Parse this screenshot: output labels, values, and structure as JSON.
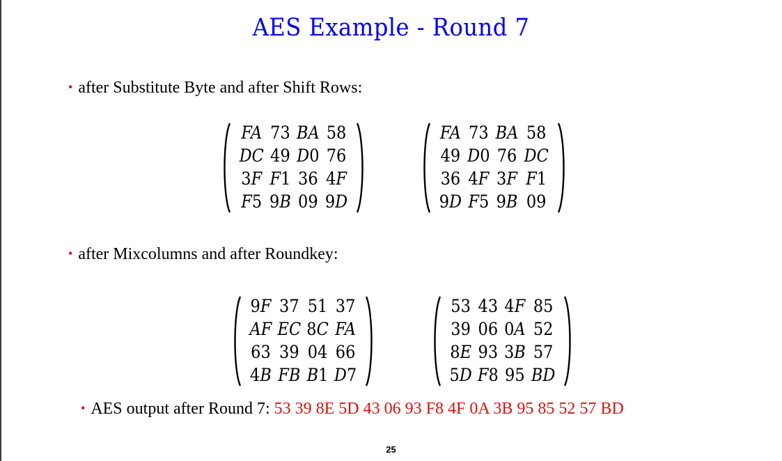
{
  "slide": {
    "title": "AES Example - Round  7",
    "page_number": "25",
    "bullets": [
      {
        "text": "after Substitute Byte and after Shift  Rows:"
      },
      {
        "text": "after Mixcolumns and after  Roundkey:"
      },
      {
        "text": "AES output after Round 7: ",
        "value": "53 39 8E 5D 43 06 93 F8 4F 0A 3B 95 85 52 57 BD"
      }
    ],
    "matrices": {
      "after_substitute_byte": [
        [
          "FA",
          "73",
          "BA",
          "58"
        ],
        [
          "DC",
          "49",
          "D0",
          "76"
        ],
        [
          "3F",
          "F1",
          "36",
          "4F"
        ],
        [
          "F5",
          "9B",
          "09",
          "9D"
        ]
      ],
      "after_shift_rows": [
        [
          "FA",
          "73",
          "BA",
          "58"
        ],
        [
          "49",
          "D0",
          "76",
          "DC"
        ],
        [
          "36",
          "4F",
          "3F",
          "F1"
        ],
        [
          "9D",
          "F5",
          "9B",
          "09"
        ]
      ],
      "after_mixcolumns": [
        [
          "9F",
          "37",
          "51",
          "37"
        ],
        [
          "AF",
          "EC",
          "8C",
          "FA"
        ],
        [
          "63",
          "39",
          "04",
          "66"
        ],
        [
          "4B",
          "FB",
          "B1",
          "D7"
        ]
      ],
      "after_roundkey": [
        [
          "53",
          "43",
          "4F",
          "85"
        ],
        [
          "39",
          "06",
          "0A",
          "52"
        ],
        [
          "8E",
          "93",
          "3B",
          "57"
        ],
        [
          "5D",
          "F8",
          "95",
          "BD"
        ]
      ]
    },
    "colors": {
      "title": "#0000ee",
      "bullet": "#e00000",
      "output_value": "#e01010"
    }
  }
}
